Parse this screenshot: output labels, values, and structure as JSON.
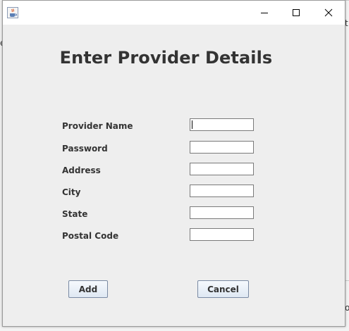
{
  "background_fragments": [
    "e",
    "t",
    "o"
  ],
  "window": {
    "app_icon": "java-cup-icon",
    "controls": {
      "minimize": "minimize-icon",
      "maximize": "maximize-icon",
      "close": "close-icon"
    }
  },
  "form": {
    "title": "Enter Provider Details",
    "fields": [
      {
        "label": "Provider Name",
        "value": "",
        "focused": true
      },
      {
        "label": "Password",
        "value": ""
      },
      {
        "label": "Address",
        "value": ""
      },
      {
        "label": "City",
        "value": ""
      },
      {
        "label": "State",
        "value": ""
      },
      {
        "label": "Postal Code",
        "value": ""
      }
    ],
    "buttons": {
      "add": "Add",
      "cancel": "Cancel"
    }
  },
  "colors": {
    "window_bg": "#eeeeee",
    "titlebar_bg": "#ffffff",
    "text": "#333333",
    "button_border": "#7a8aa3"
  }
}
